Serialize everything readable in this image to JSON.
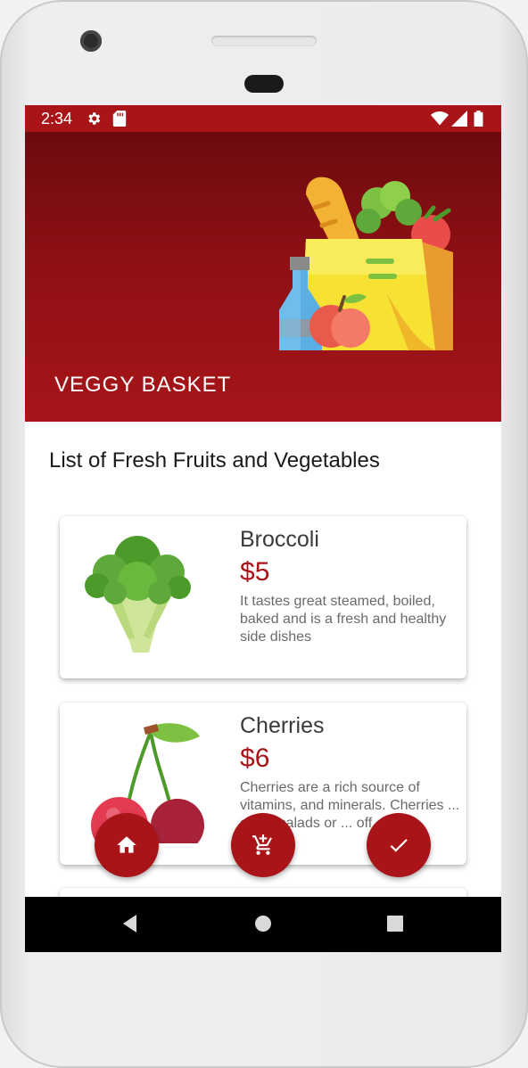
{
  "status_bar": {
    "time": "2:34",
    "icons": [
      "gear-icon",
      "sd-card-icon",
      "wifi-icon",
      "signal-icon",
      "battery-icon"
    ]
  },
  "hero": {
    "title": "VEGGY BASKET",
    "illustration": "grocery-bag-illustration"
  },
  "section_title": "List of Fresh Fruits and Vegetables",
  "products": [
    {
      "name": "Broccoli",
      "price_symbol": "$",
      "price": "5",
      "description": "It tastes great steamed, boiled, baked and is a fresh and healthy side dishes",
      "icon": "broccoli-illustration"
    },
    {
      "name": "Cherries",
      "price_symbol": "$",
      "price": "6",
      "description": "Cherries are a rich source of vitamins, and minerals. Cherries ... eat in salads or ... off ... m.",
      "icon": "cherries-illustration"
    }
  ],
  "fabs": {
    "home": "home-icon",
    "cart": "add-to-cart-icon",
    "check": "check-icon"
  },
  "nav": [
    "back-icon",
    "home-circle-icon",
    "recents-square-icon"
  ],
  "colors": {
    "primary": "#a81418",
    "hero_dark": "#6b0b0e",
    "price": "#a81418"
  }
}
